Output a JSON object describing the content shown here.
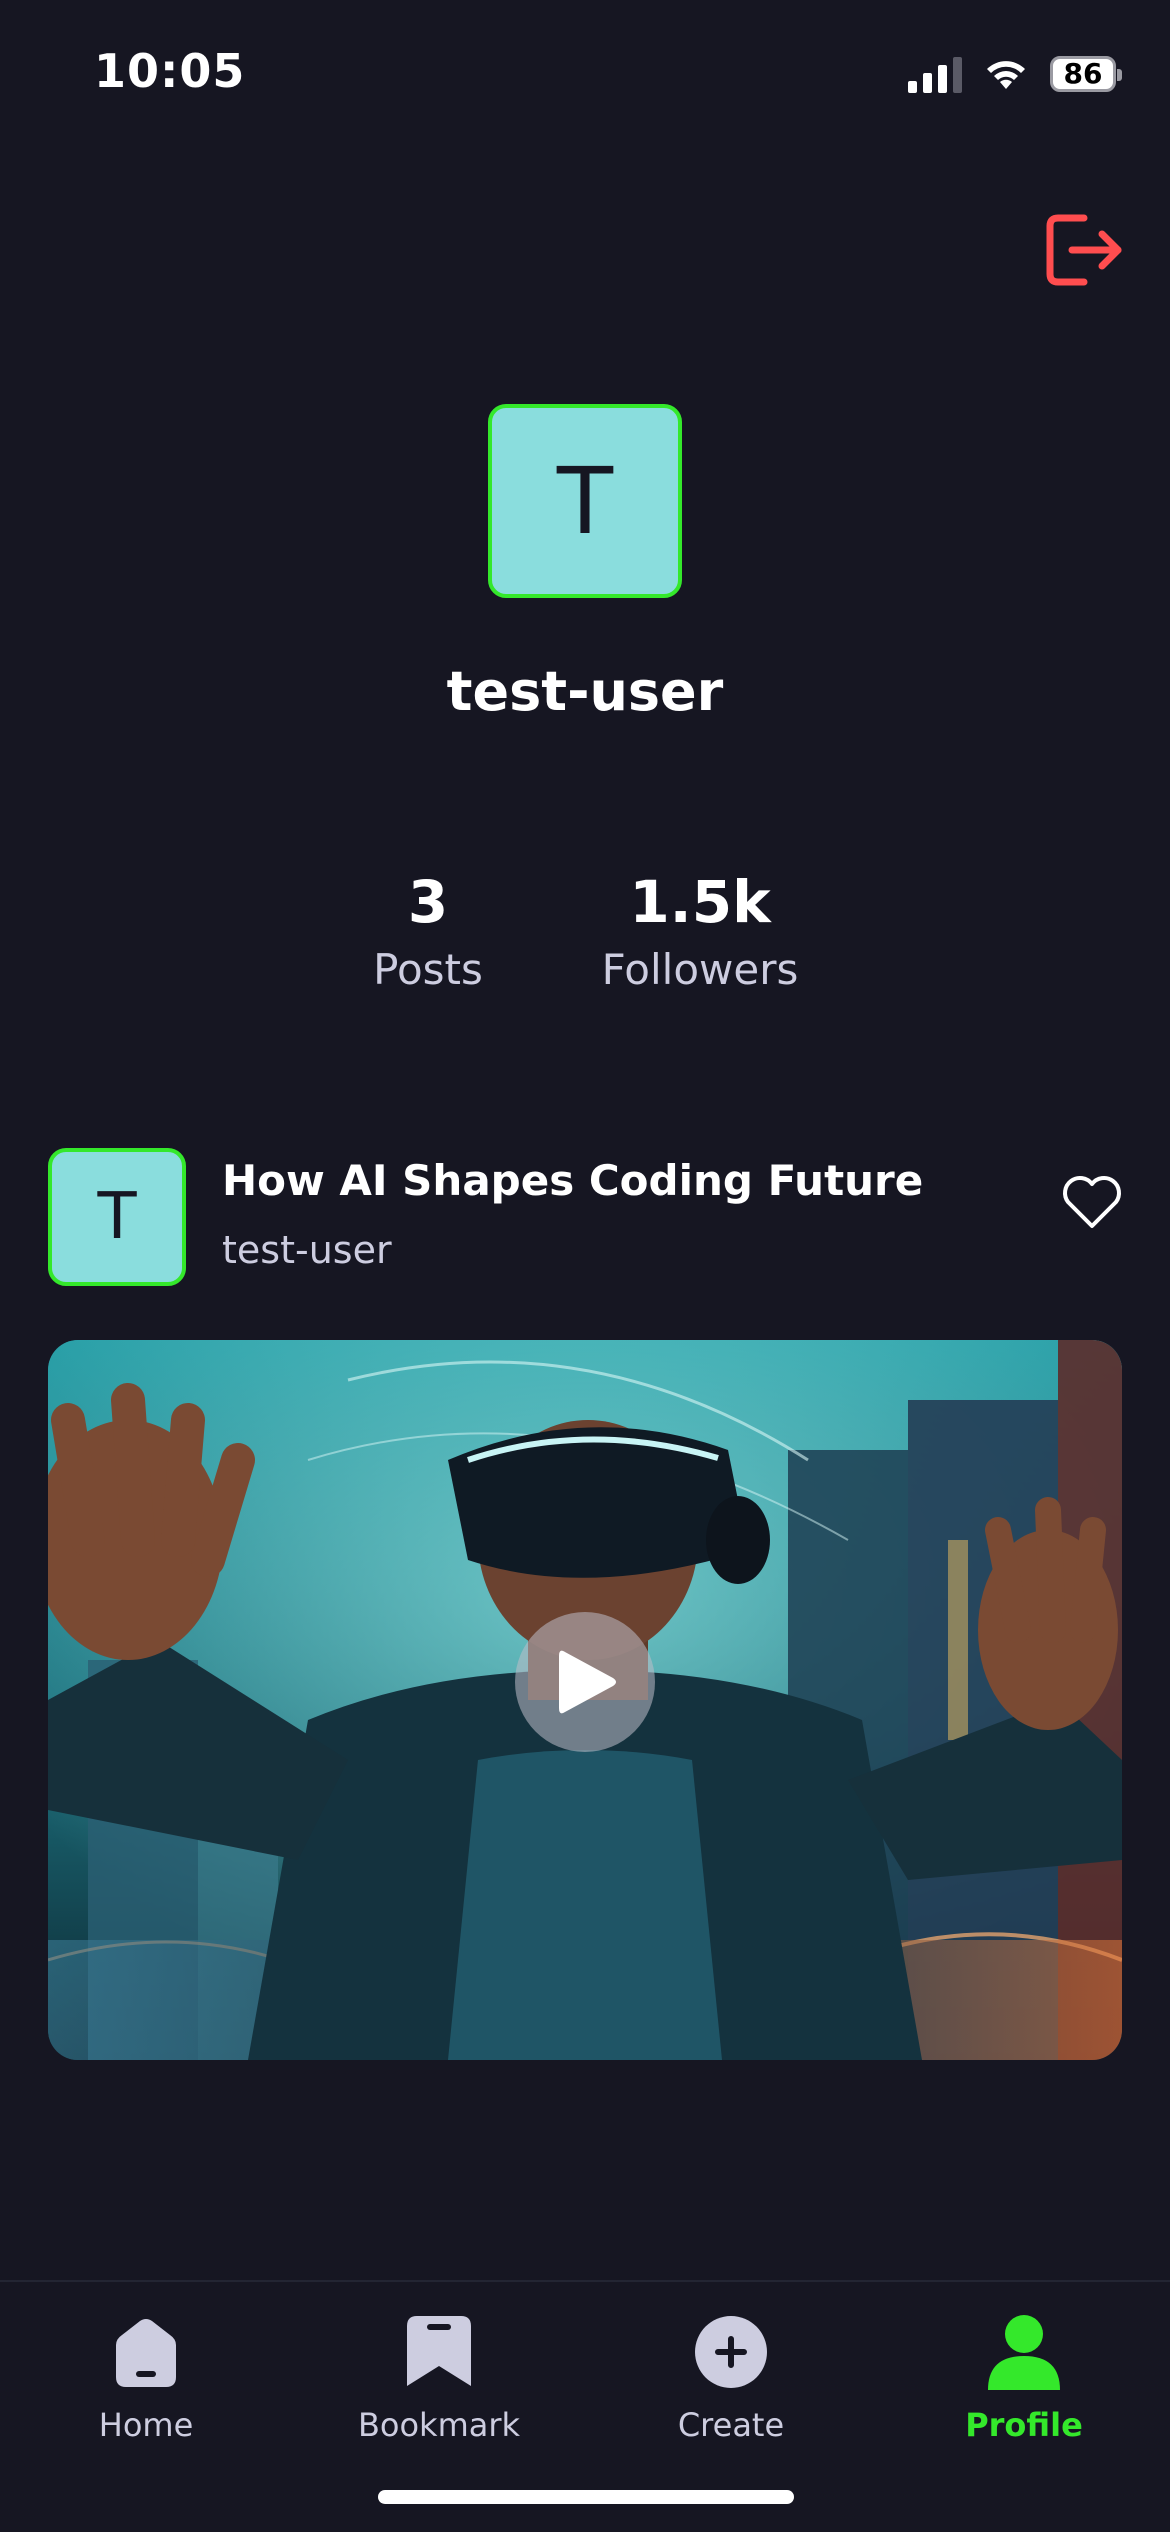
{
  "status_bar": {
    "time": "10:05",
    "battery": "86"
  },
  "profile": {
    "avatar_initial": "T",
    "username": "test-user",
    "stats": [
      {
        "value": "3",
        "label": "Posts"
      },
      {
        "value": "1.5k",
        "label": "Followers"
      }
    ]
  },
  "post": {
    "avatar_initial": "T",
    "title": "How AI Shapes Coding Future",
    "author": "test-user",
    "media": "video"
  },
  "tabs": [
    {
      "label": "Home",
      "icon": "home-icon",
      "active": false
    },
    {
      "label": "Bookmark",
      "icon": "bookmark-icon",
      "active": false
    },
    {
      "label": "Create",
      "icon": "plus-icon",
      "active": false
    },
    {
      "label": "Profile",
      "icon": "profile-icon",
      "active": true
    }
  ],
  "colors": {
    "background": "#161622",
    "accent": "#34e82b",
    "avatar_bg": "#8adddd",
    "logout": "#ff4d4f",
    "muted_text": "#cdcde0"
  }
}
